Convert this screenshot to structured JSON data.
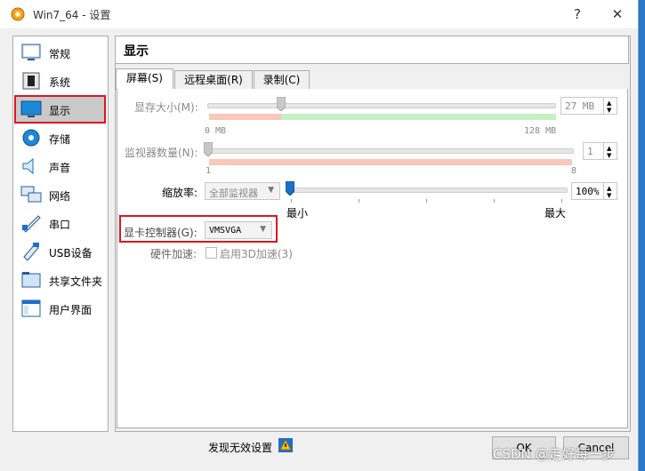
{
  "window": {
    "title": "Win7_64 - 设置",
    "help_glyph": "?",
    "close_glyph": "✕"
  },
  "sidebar": {
    "items": [
      {
        "label": "常规",
        "icon": "general-icon"
      },
      {
        "label": "系统",
        "icon": "system-chip-icon"
      },
      {
        "label": "显示",
        "icon": "display-monitor-icon",
        "selected": true
      },
      {
        "label": "存储",
        "icon": "storage-disk-icon"
      },
      {
        "label": "声音",
        "icon": "speaker-icon"
      },
      {
        "label": "网络",
        "icon": "network-icon"
      },
      {
        "label": "串口",
        "icon": "serial-port-icon"
      },
      {
        "label": "USB设备",
        "icon": "usb-icon"
      },
      {
        "label": "共享文件夹",
        "icon": "folder-icon"
      },
      {
        "label": "用户界面",
        "icon": "user-interface-icon"
      }
    ]
  },
  "page": {
    "title": "显示"
  },
  "tabs": [
    {
      "label": "屏幕(S)",
      "active": true
    },
    {
      "label": "远程桌面(R)"
    },
    {
      "label": "录制(C)"
    }
  ],
  "screen": {
    "video_memory": {
      "label": "显存大小(M):",
      "value": "27 MB",
      "min_label": "0 MB",
      "max_label": "128 MB",
      "fraction": 0.21
    },
    "monitor_count": {
      "label": "监视器数量(N):",
      "value": "1",
      "min_label": "1",
      "max_label": "8",
      "fraction": 0.0
    },
    "scale": {
      "label": "缩放率:",
      "combo_value": "全部监视器",
      "value": "100%",
      "min_label": "最小",
      "max_label": "最大",
      "fraction": 0.0
    },
    "graphics_controller": {
      "label": "显卡控制器(G):",
      "value": "VMSVGA"
    },
    "acceleration": {
      "label": "硬件加速:",
      "checkbox_label": "启用3D加速(3)",
      "checked": false
    }
  },
  "footer": {
    "invalid_settings_label": "发现无效设置",
    "ok_label": "OK",
    "cancel_label": "Cancel"
  },
  "watermark": "CSDN @走好每一步",
  "colors": {
    "selection_highlight": "#e0141e",
    "slider_green": "#c7efc4",
    "slider_red": "#f8c8b8",
    "slider_handle": "#1e6fc8"
  }
}
